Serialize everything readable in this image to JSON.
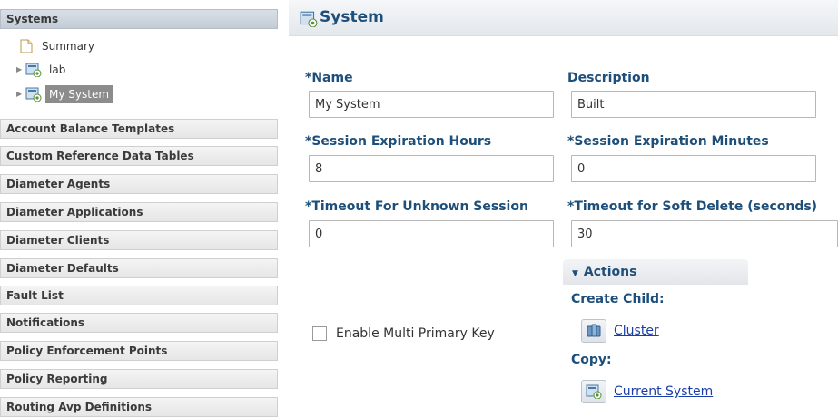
{
  "sidebar": {
    "active_section": "Systems",
    "tree": [
      {
        "label": "Summary",
        "icon": "document-icon",
        "expandable": false,
        "selected": false
      },
      {
        "label": "lab",
        "icon": "system-icon",
        "expandable": true,
        "selected": false
      },
      {
        "label": "My System",
        "icon": "system-icon",
        "expandable": true,
        "selected": true
      }
    ],
    "sections": [
      "Account Balance Templates",
      "Custom Reference Data Tables",
      "Diameter Agents",
      "Diameter Applications",
      "Diameter Clients",
      "Diameter Defaults",
      "Fault List",
      "Notifications",
      "Policy Enforcement Points",
      "Policy Reporting",
      "Routing Avp Definitions"
    ]
  },
  "panel": {
    "title": "System",
    "icon": "system-icon"
  },
  "form": {
    "name": {
      "label": "*Name",
      "value": "My System"
    },
    "description": {
      "label": "Description",
      "value": "Built"
    },
    "session_hours": {
      "label": "*Session Expiration Hours",
      "value": "8"
    },
    "session_minutes": {
      "label": "*Session Expiration Minutes",
      "value": "0"
    },
    "timeout_unknown": {
      "label": "*Timeout For Unknown Session",
      "value": "0"
    },
    "timeout_soft_delete": {
      "label": "*Timeout for Soft Delete (seconds)",
      "value": "30"
    },
    "multi_primary_key": {
      "label": "Enable Multi Primary Key",
      "checked": false
    }
  },
  "actions": {
    "title": "Actions",
    "create_child_label": "Create Child:",
    "create_child_items": [
      {
        "label": "Cluster",
        "icon": "cluster-icon"
      }
    ],
    "copy_label": "Copy:",
    "copy_items": [
      {
        "label": "Current System",
        "icon": "system-icon"
      }
    ]
  },
  "colors": {
    "label_blue": "#1d4f7a",
    "link_blue": "#1a3ea8",
    "selected_bg": "#8c8c8c",
    "active_header": "#c3ccd6"
  }
}
